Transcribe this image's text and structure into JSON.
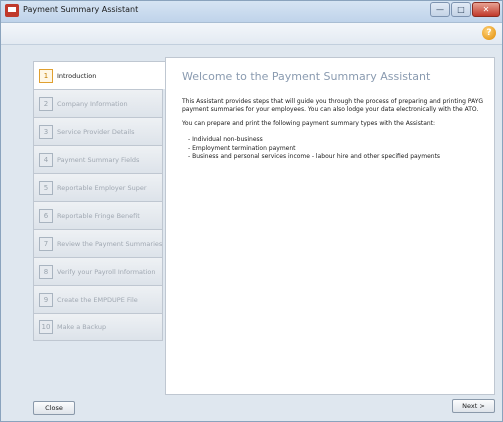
{
  "window": {
    "title": "Payment Summary Assistant",
    "controls": {
      "minimize": "—",
      "maximize": "□",
      "close": "✕"
    }
  },
  "toolbar": {
    "help_icon": "?"
  },
  "nav": {
    "items": [
      {
        "num": "1",
        "label": "Introduction",
        "active": true
      },
      {
        "num": "2",
        "label": "Company Information"
      },
      {
        "num": "3",
        "label": "Service Provider Details"
      },
      {
        "num": "4",
        "label": "Payment Summary Fields"
      },
      {
        "num": "5",
        "label": "Reportable Employer Super"
      },
      {
        "num": "6",
        "label": "Reportable Fringe Benefit"
      },
      {
        "num": "7",
        "label": "Review the Payment Summaries"
      },
      {
        "num": "8",
        "label": "Verify your Payroll Information"
      },
      {
        "num": "9",
        "label": "Create the EMPDUPE File"
      },
      {
        "num": "10",
        "label": "Make a Backup"
      }
    ]
  },
  "main": {
    "heading": "Welcome to the Payment Summary Assistant",
    "paragraph1": "This Assistant provides steps that will guide you through the process of preparing and printing PAYG payment summaries for your employees. You can also lodge your data electronically with the ATO.",
    "paragraph2": "You can prepare and print the following payment summary types with the Assistant:",
    "bullets": [
      "- Individual non-business",
      "- Employment termination payment",
      "- Business and personal services income - labour hire and other specified payments"
    ]
  },
  "footer": {
    "close_label": "Close",
    "next_label": "Next >"
  },
  "colors": {
    "accent": "#e0a030",
    "title_bar": "#bfd3ea",
    "heading": "#8a9bb0"
  }
}
